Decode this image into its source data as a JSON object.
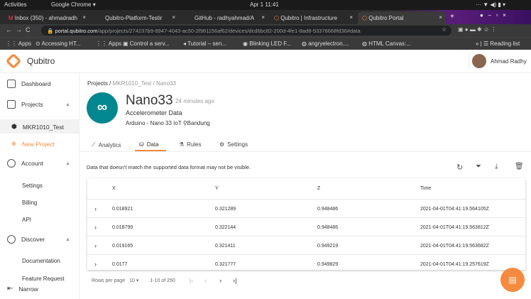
{
  "os": {
    "activities": "Activities",
    "app": "Google Chrome ▾",
    "clock": "Apr 1  11:41"
  },
  "browser": {
    "tabs": [
      {
        "label": "Inbox (350) - ahmadradh"
      },
      {
        "label": "Qubitro-Platform-Testir"
      },
      {
        "label": "GitHub - radhyahmad/A"
      },
      {
        "label": "Qubitro | Infrastructure"
      },
      {
        "label": "Qubitro Portal"
      }
    ],
    "url_host": "portal.qubitro.com",
    "url_path": "/app/projects/274237b9-8947-4043-ac50-2f981156af62/devices/dcd6bc82-200d-4fe1-8ad8-53376668fd36#data",
    "bookmarks": [
      "Apps",
      "Accessing HT...",
      "Apps",
      "Control a serv...",
      "Tutorial – sen...",
      "Blinking LED F...",
      "angryelectron....",
      "HTML Canvas:..."
    ],
    "reading_list": "Reading list"
  },
  "header": {
    "brand": "Qubitro",
    "user": "Ahmad Radhy"
  },
  "sidebar": {
    "dashboard": "Dashboard",
    "projects": "Projects",
    "project": "MKR1010_Test",
    "new_project": "New Project",
    "account": "Account",
    "settings": "Settings",
    "billing": "Billing",
    "api": "API",
    "discover": "Discover",
    "documentation": "Documentation",
    "feature_request": "Feature Request",
    "narrow": "Narrow"
  },
  "breadcrumb": {
    "root": "Projects /",
    "project": "MKR1010_Test /",
    "device": "Nano33"
  },
  "device": {
    "name": "Nano33",
    "updated": "24 minutes ago",
    "description": "Accelerometer Data",
    "meta": "Arduino - Nano 33 IoT",
    "location": "Bandung"
  },
  "tabs": {
    "analytics": "Analytics",
    "data": "Data",
    "rules": "Rules",
    "settings": "Settings"
  },
  "notice": "Data that doesn't match the supported data format may not be visible.",
  "table": {
    "columns": [
      "X",
      "Y",
      "Z",
      "Time"
    ],
    "rows": [
      [
        "0.018921",
        "0.321289",
        "0.948486",
        "2021-04-01T04:41:19.564105Z"
      ],
      [
        "0.018799",
        "0.322144",
        "0.948486",
        "2021-04-01T04:41:19.563812Z"
      ],
      [
        "0.019165",
        "0.321411",
        "0.949219",
        "2021-04-01T04:41:19.563682Z"
      ],
      [
        "0.0177",
        "0.321777",
        "0.949829",
        "2021-04-01T04:41:19.257619Z"
      ]
    ]
  },
  "pagination": {
    "rows_label": "Rows per page",
    "rows_value": "10",
    "range": "1-10 of 250"
  },
  "colors": {
    "accent": "#f68b3f",
    "arduino": "#00878f"
  }
}
